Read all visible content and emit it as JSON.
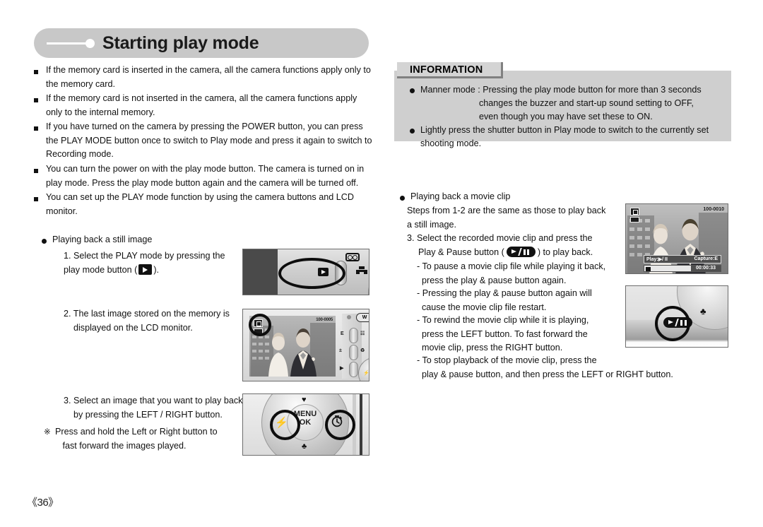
{
  "header": {
    "title": "Starting play mode"
  },
  "left_column": {
    "bullets": [
      "If the memory card is inserted in the camera, all the camera functions apply only to the memory card.",
      "If the memory card is not inserted in the camera, all the camera functions apply only to the internal memory.",
      "If you have turned on the camera by pressing the POWER button, you can press the PLAY MODE button once to switch to Play mode and press it again to switch to Recording mode.",
      "You can turn the power on with the play mode button. The camera is turned on in play mode. Press the play mode button again and the camera will be turned off.",
      "You can set up the PLAY mode function by using the camera buttons and LCD monitor."
    ],
    "section_title": "Playing back a still image",
    "step1_a": "1. Select the PLAY mode by pressing the",
    "step1_b_pre": "play mode button (",
    "step1_b_post": ").",
    "step2": "2. The last image stored on the memory is\n    displayed on the LCD monitor.",
    "step3": "3. Select an image that you want to play back\n    by pressing the LEFT / RIGHT button.",
    "note_mark": "※",
    "note": "Press and hold the Left or Right button to\n   fast forward the images played."
  },
  "information": {
    "tab_label": "INFORMATION",
    "items": [
      {
        "line1": "Manner mode : Pressing the play mode button for more than 3 seconds",
        "line2": "changes the buzzer and start-up sound setting to OFF,",
        "line3": "even though you may have set these to ON."
      },
      {
        "line1": "Lightly press the shutter button in Play mode to switch to the currently set",
        "line2": "shooting mode."
      }
    ]
  },
  "right_column": {
    "section_title": "Playing back a movie clip",
    "intro": "Steps from 1-2 are the same as those to play back\na still image.",
    "step3_a": "3. Select the recorded movie clip and press the",
    "step3_b_pre": "Play & Pause button (",
    "step3_b_post": ") to play back.",
    "sub_items": [
      "- To pause a movie clip file while playing it back,\n  press the play & pause button again.",
      "- Pressing the play & pause button again will\n  cause the movie clip file restart.",
      "- To rewind the movie clip while it is playing,\n  press the LEFT button. To fast forward the\n  movie clip, press the RIGHT button.",
      "- To stop playback of the movie clip, press the\n  play & pause button, and then press the LEFT or RIGHT button."
    ]
  },
  "figures": {
    "lcd_still": {
      "file_number": "100-0005",
      "zoom_wide_label": "W",
      "key_label_e": "E"
    },
    "nav_pad": {
      "center_line1": "MENU",
      "center_line2": "OK"
    },
    "lcd_movie": {
      "file_number": "100-0010",
      "osd_play": "Play:▶/ II",
      "osd_capture": "Capture:E",
      "elapsed_time": "00:00:33"
    }
  },
  "footer": {
    "page_number": "《36》"
  },
  "colors": {
    "header_banner": "#c8c8c8",
    "info_box": "#cfcfcf",
    "info_tab": "#d4d4d4",
    "text": "#111111"
  }
}
